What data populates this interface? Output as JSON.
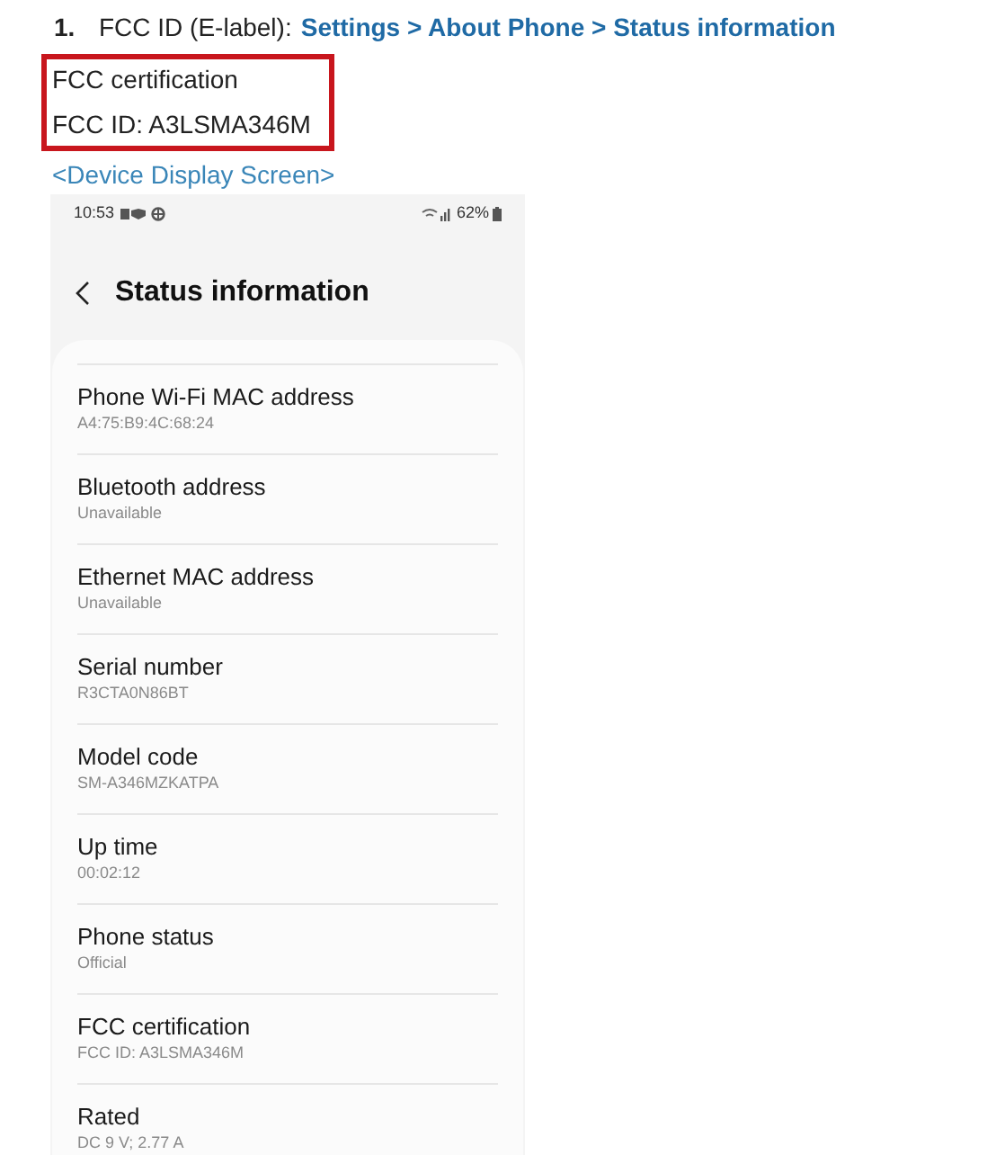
{
  "step": {
    "number": "1.",
    "label": "FCC ID (E-label):",
    "path": "Settings > About Phone > Status information"
  },
  "highlight": {
    "lines": [
      "FCC certification",
      "FCC ID: A3LSMA346M"
    ]
  },
  "caption": "<Device Display Screen>",
  "phone": {
    "status_bar": {
      "time": "10:53",
      "battery": "62%"
    },
    "title": "Status information",
    "items": [
      {
        "label": "Phone Wi-Fi MAC address",
        "value": "A4:75:B9:4C:68:24"
      },
      {
        "label": "Bluetooth address",
        "value": "Unavailable"
      },
      {
        "label": "Ethernet MAC address",
        "value": "Unavailable"
      },
      {
        "label": "Serial number",
        "value": "R3CTA0N86BT"
      },
      {
        "label": "Model code",
        "value": "SM-A346MZKATPA"
      },
      {
        "label": "Up time",
        "value": "00:02:12"
      },
      {
        "label": "Phone status",
        "value": "Official"
      },
      {
        "label": "FCC certification",
        "value": "FCC ID: A3LSMA346M"
      },
      {
        "label": "Rated",
        "value": "DC 9 V; 2.77 A"
      }
    ]
  }
}
